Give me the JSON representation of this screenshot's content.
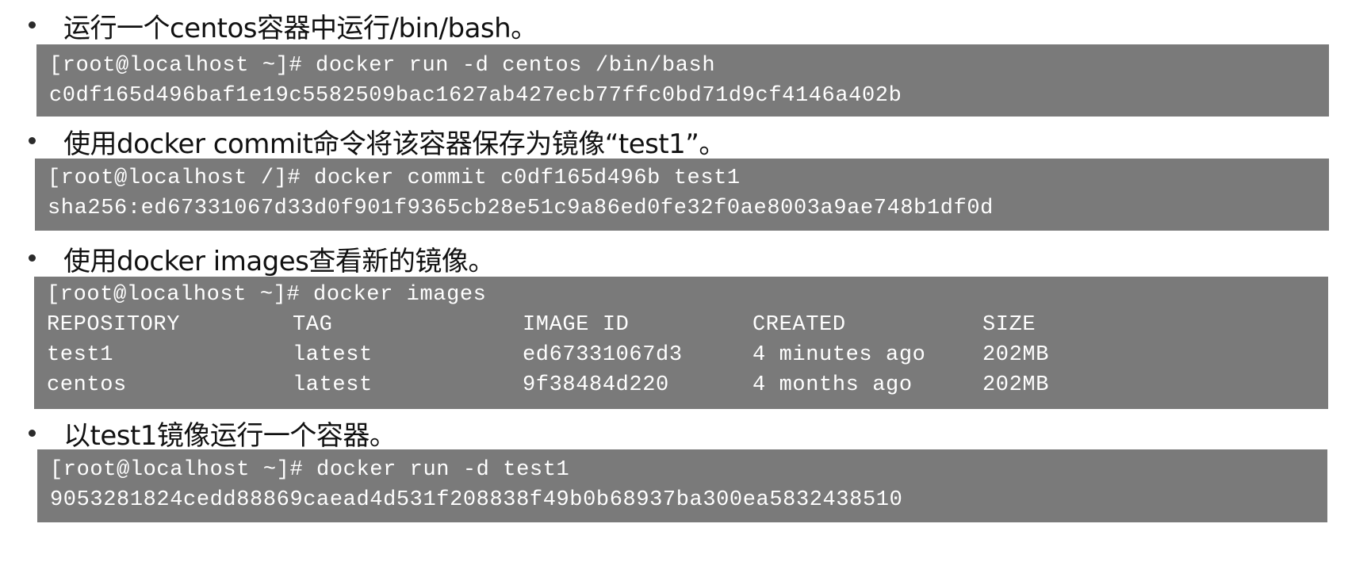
{
  "steps": [
    {
      "text": "运行一个centos容器中运行/bin/bash。",
      "command": "[root@localhost ~]# docker run -d centos /bin/bash",
      "output": "c0df165d496baf1e19c5582509bac1627ab427ecb77ffc0bd71d9cf4146a402b"
    },
    {
      "text": "使用docker commit命令将该容器保存为镜像“test1”。",
      "command": "[root@localhost /]# docker commit c0df165d496b test1",
      "output": "sha256:ed67331067d33d0f901f9365cb28e51c9a86ed0fe32f0ae8003a9ae748b1df0d"
    },
    {
      "text": "使用docker images查看新的镜像。",
      "command": "[root@localhost ~]# docker images",
      "table": {
        "headers": [
          "REPOSITORY",
          "TAG",
          "IMAGE ID",
          "CREATED",
          "SIZE"
        ],
        "rows": [
          [
            "test1",
            "latest",
            "ed67331067d3",
            "4 minutes ago",
            "202MB"
          ],
          [
            "centos",
            "latest",
            "9f38484d220",
            "4 months ago",
            "202MB"
          ]
        ]
      }
    },
    {
      "text": "以test1镜像运行一个容器。",
      "command": "[root@localhost ~]# docker run -d test1",
      "output": "9053281824cedd88869caead4d531f208838f49b0b68937ba300ea5832438510"
    }
  ],
  "colors": {
    "code_background": "#7a7a7a",
    "code_text": "#ffffff",
    "body_text": "#111111"
  }
}
